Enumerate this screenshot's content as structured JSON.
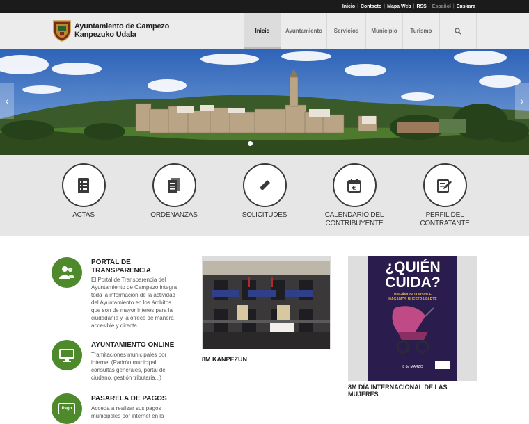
{
  "topbar": {
    "links": [
      "Inicio",
      "Contacto",
      "Mapa Web",
      "RSS"
    ],
    "lang_muted": "Español",
    "lang_active": "Euskara"
  },
  "header": {
    "title_line1": "Ayuntamiento de Campezo",
    "title_line2": "Kanpezuko Udala"
  },
  "nav": {
    "items": [
      "Inicio",
      "Ayuntamiento",
      "Servicios",
      "Municipio",
      "Turismo"
    ],
    "active": "Inicio"
  },
  "hero": {
    "prev": "‹",
    "next": "›",
    "slides": 2,
    "active_slide": 1
  },
  "quick_links": [
    {
      "label": "ACTAS",
      "icon": "document-list-icon"
    },
    {
      "label": "ORDENANZAS",
      "icon": "document-stack-icon"
    },
    {
      "label": "SOLICITUDES",
      "icon": "pencil-icon"
    },
    {
      "label": "CALENDARIO DEL CONTRIBUYENTE",
      "icon": "calendar-euro-icon"
    },
    {
      "label": "PERFIL DEL CONTRATANTE",
      "icon": "contract-sign-icon"
    }
  ],
  "services": [
    {
      "title": "PORTAL DE TRANSPARENCIA",
      "text": "El Portal de Transparencia del Ayuntamiento de Campezo integra toda la información de la actividad del Ayuntamiento en los ámbitos que son de mayor interés para la ciudadanía y la ofrece de manera accesible y directa.",
      "icon": "people-icon"
    },
    {
      "title": "AYUNTAMIENTO ONLINE",
      "text": "Tramitaciones municipales por internet (Padrón municipal, consultas generales, portal del ciudano, gestión tributaria...)",
      "icon": "monitor-icon"
    },
    {
      "title": "PASARELA DE PAGOS",
      "text": "Acceda a realizar sus pagos municipales por internet en la",
      "icon": "pay-card-icon",
      "icon_text": "Pago"
    }
  ],
  "news": [
    {
      "caption": "8M KANPEZUN"
    },
    {
      "caption": "8M DÍA INTERNACIONAL DE LAS MUJERES"
    }
  ],
  "poster": {
    "headline_1": "¿QUIÉN",
    "headline_2": "CUIDA?",
    "subtitle_1": "HAGÁMOSLO VISIBLE",
    "subtitle_2": "HAGAMOS NUESTRA PARTE",
    "date": "8 de MARZO"
  },
  "colors": {
    "green": "#4e8a2b",
    "topbar": "#1b1b1b",
    "poster_bg": "#2a1d4d",
    "poster_accent": "#e8b04a"
  }
}
